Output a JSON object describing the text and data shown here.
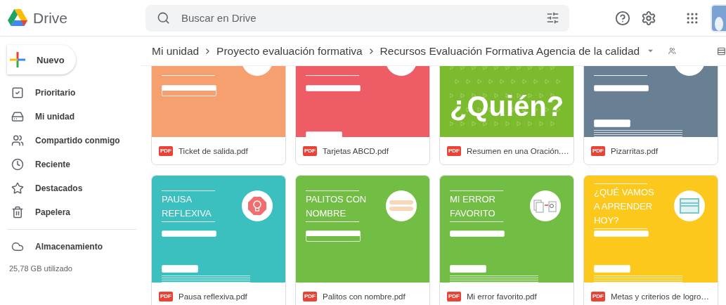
{
  "app": {
    "name": "Drive"
  },
  "search": {
    "placeholder": "Buscar en Drive"
  },
  "new_button": {
    "label": "Nuevo"
  },
  "sidebar": {
    "items": [
      {
        "label": "Prioritario",
        "selected": false
      },
      {
        "label": "Mi unidad",
        "selected": false
      },
      {
        "label": "Compartido conmigo",
        "selected": false
      },
      {
        "label": "Reciente",
        "selected": false
      },
      {
        "label": "Destacados",
        "selected": false
      },
      {
        "label": "Papelera",
        "selected": false
      }
    ]
  },
  "storage": {
    "label": "Almacenamiento",
    "usage": "25,78 GB utilizado"
  },
  "breadcrumb": [
    "Mi unidad",
    "Proyecto evaluación formativa",
    "Recursos Evaluación Formativa Agencia de la calidad"
  ],
  "files": [
    {
      "name": "Ticket de salida.pdf",
      "type_label": "PDF",
      "color": "#f5a06e",
      "thumbnail": {
        "kind": "sheet",
        "badge": {
          "kind": "plain"
        },
        "blocks": [
          {
            "kind": "when"
          }
        ]
      }
    },
    {
      "name": "Tarjetas ABCD.pdf",
      "type_label": "PDF",
      "color": "#ee5c66",
      "thumbnail": {
        "kind": "sheet",
        "badge": {
          "kind": "plain"
        },
        "blocks": [
          {
            "kind": "when"
          },
          {
            "kind": "what_low"
          }
        ]
      }
    },
    {
      "name": "Resumen en una Oración.…",
      "type_label": "PDF",
      "color": "#7cbb2e",
      "thumbnail": {
        "kind": "big_word",
        "heading": [
          "¿Quién?"
        ]
      }
    },
    {
      "name": "Pizarritas.pdf",
      "type_label": "PDF",
      "color": "#687f94",
      "thumbnail": {
        "kind": "sheet",
        "badge": {
          "kind": "plain"
        },
        "blocks": [
          {
            "kind": "when"
          },
          {
            "kind": "what"
          }
        ]
      }
    },
    {
      "name": "Pausa reflexiva.pdf",
      "type_label": "PDF",
      "color": "#3bbfbf",
      "thumbnail": {
        "kind": "sheet",
        "heading": [
          "PAUSA",
          "REFLEXIVA"
        ],
        "badge": {
          "kind": "bulb"
        },
        "blocks": [
          {
            "kind": "when"
          },
          {
            "kind": "what"
          }
        ]
      }
    },
    {
      "name": "Palitos con nombre.pdf",
      "type_label": "PDF",
      "color": "#72bd44",
      "thumbnail": {
        "kind": "sheet",
        "heading": [
          "PALITOS CON",
          "NOMBRE"
        ],
        "badge": {
          "kind": "sticks"
        },
        "blocks": [
          {
            "kind": "when"
          }
        ]
      }
    },
    {
      "name": "Mi error favorito.pdf",
      "type_label": "PDF",
      "color": "#72bd44",
      "thumbnail": {
        "kind": "sheet",
        "heading": [
          "MI ERROR",
          "FAVORITO"
        ],
        "badge": {
          "kind": "docs"
        },
        "blocks": [
          {
            "kind": "when"
          },
          {
            "kind": "what"
          }
        ]
      }
    },
    {
      "name": "Metas y criterios de logro…",
      "type_label": "PDF",
      "color": "#fcc81c",
      "thumbnail": {
        "kind": "sheet",
        "heading": [
          "¿QUÉ VAMOS",
          "A APRENDER",
          "HOY?"
        ],
        "badge": {
          "kind": "window"
        },
        "blocks": [
          {
            "kind": "when"
          },
          {
            "kind": "what"
          }
        ]
      }
    }
  ]
}
